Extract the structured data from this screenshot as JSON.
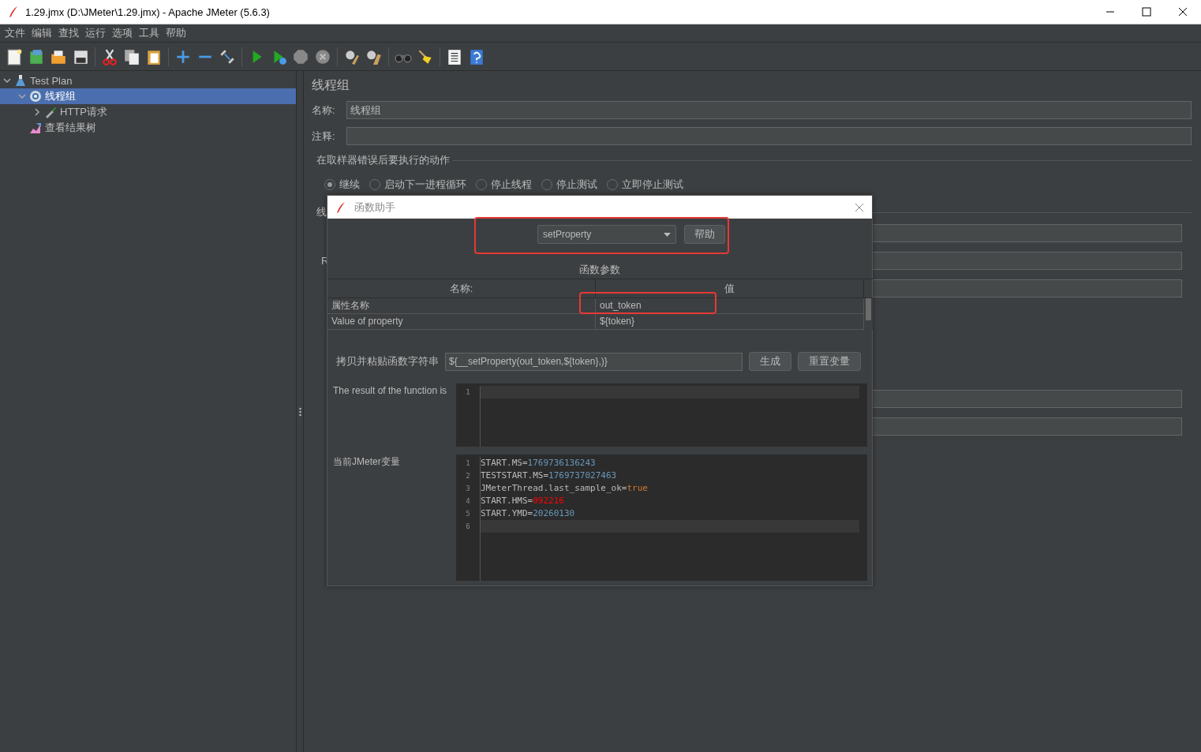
{
  "window": {
    "title": "1.29.jmx (D:\\JMeter\\1.29.jmx) - Apache JMeter (5.6.3)"
  },
  "menu": [
    "文件",
    "编辑",
    "查找",
    "运行",
    "选项",
    "工具",
    "帮助"
  ],
  "tree": [
    {
      "label": "Test Plan",
      "kind": "plan",
      "expanded": true,
      "selected": false,
      "children": [
        {
          "label": "线程组",
          "kind": "threads",
          "expanded": true,
          "selected": true,
          "children": [
            {
              "label": "HTTP请求",
              "kind": "sampler",
              "expanded": false,
              "selected": false
            }
          ]
        },
        {
          "label": "查看结果树",
          "kind": "listener",
          "selected": false
        }
      ]
    }
  ],
  "panel": {
    "title": "线程组",
    "name_label": "名称:",
    "name_value": "线程组",
    "comment_label": "注释:",
    "error_group": {
      "title": "在取样器错误后要执行的动作",
      "options": [
        {
          "label": "继续",
          "selected": true
        },
        {
          "label": "启动下一进程循环",
          "selected": false
        },
        {
          "label": "停止线程",
          "selected": false
        },
        {
          "label": "停止测试",
          "selected": false
        },
        {
          "label": "立即停止测试",
          "selected": false
        }
      ]
    },
    "thread_section": {
      "title": "线",
      "rows": [
        {
          "kind": "field"
        },
        {
          "kind": "field",
          "label": "R"
        },
        {
          "kind": "field"
        },
        {
          "kind": "gap"
        },
        {
          "kind": "field"
        },
        {
          "kind": "field"
        }
      ]
    }
  },
  "dialog": {
    "title": "函数助手",
    "function": "setProperty",
    "help_button": "帮助",
    "params_title": "函数参数",
    "columns": [
      "名称:",
      "值"
    ],
    "params": [
      {
        "name": "属性名称",
        "value": "out_token"
      },
      {
        "name": "Value of property",
        "value": "${token}"
      }
    ],
    "copy_label": "拷贝并粘贴函数字符串",
    "copy_value": "${__setProperty(out_token,${token},)}",
    "buttons": [
      "生成",
      "重置变量"
    ],
    "result_label": "The result of the function is",
    "result_lines": [
      {
        "number": "1",
        "current": true
      }
    ],
    "variables_label": "当前JMeter变量",
    "variables": [
      {
        "number": "1",
        "key": "START.MS=",
        "value": "1769736136243",
        "kind": "number",
        "current": false
      },
      {
        "number": "2",
        "key": "TESTSTART.MS=",
        "value": "1769737027463",
        "kind": "number",
        "current": false
      },
      {
        "number": "3",
        "key": "JMeterThread.last_sample_ok=",
        "value": "true",
        "kind": "boolean",
        "current": false
      },
      {
        "number": "4",
        "key": "START.HMS=",
        "value": "092216",
        "kind": "invalid",
        "current": false
      },
      {
        "number": "5",
        "key": "START.YMD=",
        "value": "20260130",
        "kind": "number",
        "current": false
      },
      {
        "number": "6",
        "current": true
      }
    ]
  }
}
